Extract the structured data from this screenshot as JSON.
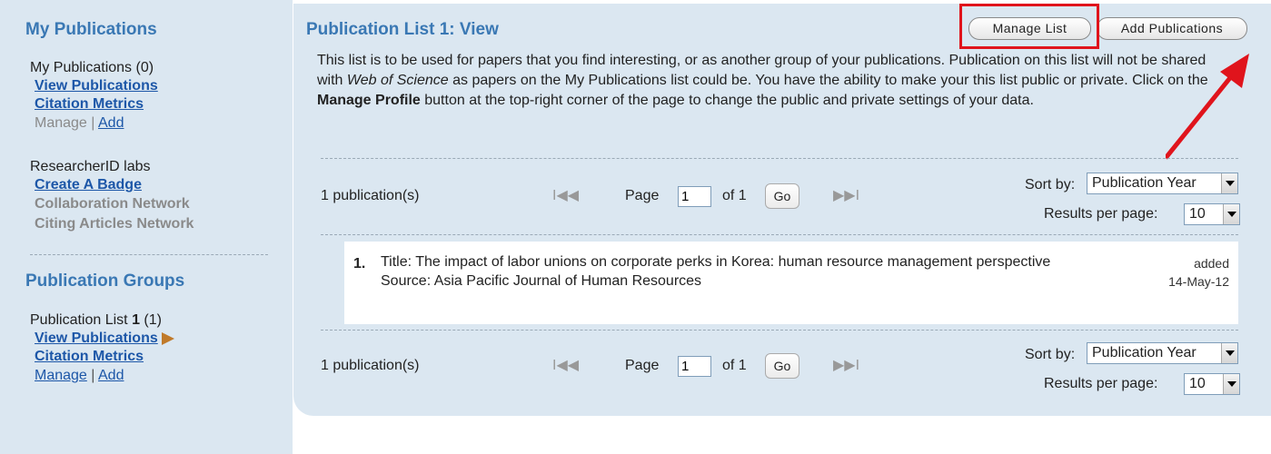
{
  "sidebar": {
    "my_publications_heading": "My Publications",
    "my_publications_count": "My Publications (0)",
    "view_publications": "View Publications",
    "citation_metrics": "Citation Metrics",
    "manage": "Manage",
    "sep": " | ",
    "add": "Add",
    "labs_heading": "ResearcherID labs",
    "create_badge": "Create A Badge",
    "collaboration_network": "Collaboration Network",
    "citing_articles_network": "Citing Articles Network",
    "groups_heading": "Publication Groups",
    "group1_label_prefix": "Publication List ",
    "group1_label_num": "1",
    "group1_label_count": " (1)",
    "group1_view": "View Publications",
    "group1_metrics": "Citation Metrics",
    "group1_manage": "Manage",
    "group1_add": "Add"
  },
  "panel": {
    "title": "Publication List 1: View",
    "manage_list_button": "Manage List",
    "add_publications_button": "Add Publications",
    "desc_1": "This list is to be used for papers that you find interesting, or as another group of your publications. Publication on this list will not be shared with ",
    "desc_wos": "Web of Science",
    "desc_2": " as papers on the My Publications list could be. You have the ability to make your this list public or private. Click on the ",
    "desc_manage_profile": "Manage Profile",
    "desc_3": " button at the top-right corner of the page to change the public and private settings of your data."
  },
  "pager": {
    "count": "1 publication(s)",
    "first": "I◀◀",
    "prev": "◀",
    "page_label": "Page",
    "page_value": "1",
    "of_label": "of 1",
    "go": "Go",
    "next": "▶",
    "last": "▶▶I",
    "sort_label": "Sort by:",
    "sort_value": "Publication Year",
    "rpp_label": "Results per page:",
    "rpp_value": "10"
  },
  "record": {
    "number": "1.",
    "title_line": "Title: The impact of labor unions on corporate perks in Korea: human resource management perspective",
    "source_line": "Source: Asia Pacific Journal of Human Resources",
    "added_label": "added",
    "added_date": "14-May-12"
  },
  "colors": {
    "panel_bg": "#dbe7f1",
    "heading": "#3a78b4",
    "link": "#1d57a8",
    "highlight": "#e0141c"
  }
}
